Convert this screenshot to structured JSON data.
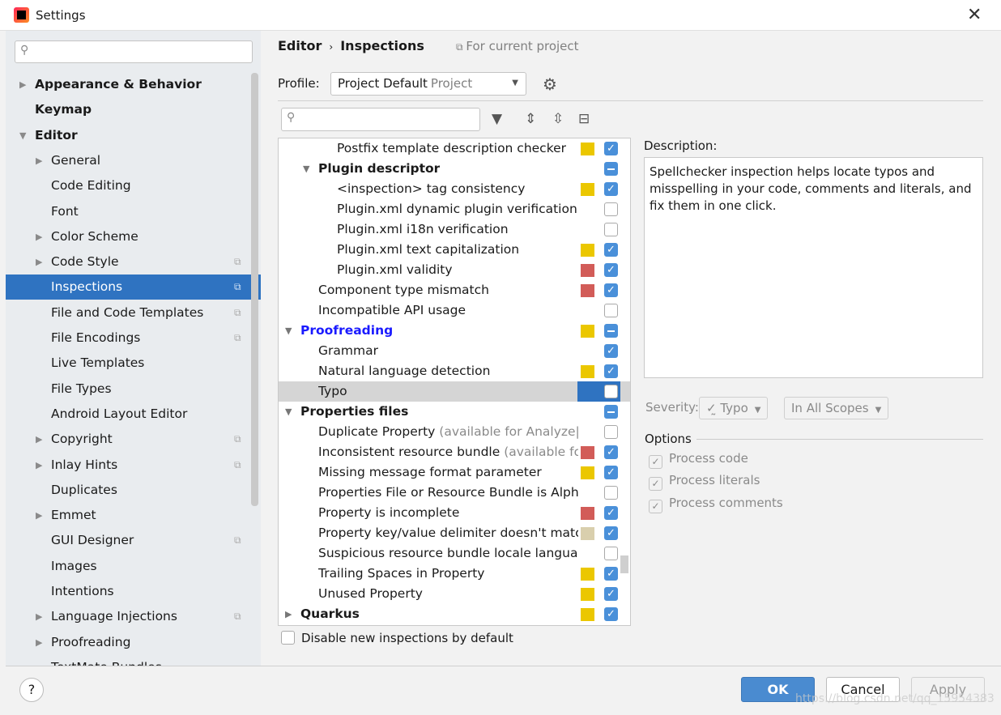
{
  "window": {
    "title": "Settings",
    "close": "✕"
  },
  "sidebar": {
    "search_placeholder": "",
    "items": [
      {
        "label": "Appearance & Behavior",
        "level": 0,
        "bold": true,
        "arrow": "right"
      },
      {
        "label": "Keymap",
        "level": 0,
        "bold": true
      },
      {
        "label": "Editor",
        "level": 0,
        "bold": true,
        "arrow": "down"
      },
      {
        "label": "General",
        "level": 1,
        "arrow": "right"
      },
      {
        "label": "Code Editing",
        "level": 1
      },
      {
        "label": "Font",
        "level": 1
      },
      {
        "label": "Color Scheme",
        "level": 1,
        "arrow": "right"
      },
      {
        "label": "Code Style",
        "level": 1,
        "arrow": "right",
        "project": true
      },
      {
        "label": "Inspections",
        "level": 1,
        "project": true,
        "selected": true
      },
      {
        "label": "File and Code Templates",
        "level": 1,
        "project": true
      },
      {
        "label": "File Encodings",
        "level": 1,
        "project": true
      },
      {
        "label": "Live Templates",
        "level": 1
      },
      {
        "label": "File Types",
        "level": 1
      },
      {
        "label": "Android Layout Editor",
        "level": 1
      },
      {
        "label": "Copyright",
        "level": 1,
        "arrow": "right",
        "project": true
      },
      {
        "label": "Inlay Hints",
        "level": 1,
        "arrow": "right",
        "project": true
      },
      {
        "label": "Duplicates",
        "level": 1
      },
      {
        "label": "Emmet",
        "level": 1,
        "arrow": "right"
      },
      {
        "label": "GUI Designer",
        "level": 1,
        "project": true
      },
      {
        "label": "Images",
        "level": 1
      },
      {
        "label": "Intentions",
        "level": 1
      },
      {
        "label": "Language Injections",
        "level": 1,
        "arrow": "right",
        "project": true
      },
      {
        "label": "Proofreading",
        "level": 1,
        "arrow": "right"
      },
      {
        "label": "TextMate Bundles",
        "level": 1
      }
    ]
  },
  "header": {
    "breadcrumb": [
      "Editor",
      "Inspections"
    ],
    "separator": "›",
    "scope": "For current project"
  },
  "profile": {
    "label": "Profile:",
    "value": "Project Default",
    "kind": "Project"
  },
  "colors": {
    "warning": "#ebc700",
    "error": "#d25c58",
    "weak": "#d9cfad",
    "accent": "#2f73c1",
    "modified": "#1a1aff"
  },
  "tree": {
    "rows": [
      {
        "label": "Postfix template description checker",
        "level": 3,
        "sev": "warning",
        "check": "on"
      },
      {
        "label": "Plugin descriptor",
        "level": 2,
        "group": true,
        "arrow": "down",
        "check": "part"
      },
      {
        "label": "<inspection> tag consistency",
        "level": 3,
        "sev": "warning",
        "check": "on"
      },
      {
        "label": "Plugin.xml dynamic plugin verification",
        "level": 3,
        "check": "off"
      },
      {
        "label": "Plugin.xml i18n verification",
        "level": 3,
        "check": "off"
      },
      {
        "label": "Plugin.xml text capitalization",
        "level": 3,
        "sev": "warning",
        "check": "on"
      },
      {
        "label": "Plugin.xml validity",
        "level": 3,
        "sev": "error",
        "check": "on"
      },
      {
        "label": "Component type mismatch",
        "level": 2,
        "sev": "error",
        "check": "on"
      },
      {
        "label": "Incompatible API usage",
        "level": 2,
        "check": "off"
      },
      {
        "label": "Proofreading",
        "level": 1,
        "group": true,
        "modified": true,
        "arrow": "down",
        "sev": "warning",
        "check": "part"
      },
      {
        "label": "Grammar",
        "level": 2,
        "check": "on"
      },
      {
        "label": "Natural language detection",
        "level": 2,
        "sev": "warning",
        "check": "on"
      },
      {
        "label": "Typo",
        "level": 2,
        "check": "off",
        "selected": true
      },
      {
        "label": "Properties files",
        "level": 1,
        "group": true,
        "arrow": "down",
        "check": "part"
      },
      {
        "label": "Duplicate Property",
        "hint": " (available for Analyze|Inspect Code)",
        "level": 2,
        "check": "off"
      },
      {
        "label": "Inconsistent resource bundle",
        "hint": " (available for Analyze|Inspect Code)",
        "level": 2,
        "sev": "error",
        "check": "on"
      },
      {
        "label": "Missing message format parameter",
        "level": 2,
        "sev": "warning",
        "check": "on"
      },
      {
        "label": "Properties File or Resource Bundle is Alphabetically Sorted",
        "level": 2,
        "check": "off"
      },
      {
        "label": "Property is incomplete",
        "level": 2,
        "sev": "error",
        "check": "on"
      },
      {
        "label": "Property key/value delimiter doesn't match code style settings",
        "level": 2,
        "sev": "weak",
        "check": "on"
      },
      {
        "label": "Suspicious resource bundle locale languages",
        "level": 2,
        "check": "off"
      },
      {
        "label": "Trailing Spaces in Property",
        "level": 2,
        "sev": "warning",
        "check": "on"
      },
      {
        "label": "Unused Property",
        "level": 2,
        "sev": "warning",
        "check": "on"
      },
      {
        "label": "Quarkus",
        "level": 1,
        "group": true,
        "arrow": "right",
        "sev": "warning",
        "check": "on"
      }
    ]
  },
  "description": {
    "label": "Description:",
    "text": "Spellchecker inspection helps locate typos and misspelling in your code, comments and literals, and fix them in one click."
  },
  "severity": {
    "label": "Severity:",
    "value": "Typo",
    "scope": "In All Scopes"
  },
  "options": {
    "label": "Options",
    "items": [
      "Process code",
      "Process literals",
      "Process comments"
    ]
  },
  "disable_new": "Disable new inspections by default",
  "footer": {
    "help": "?",
    "ok": "OK",
    "cancel": "Cancel",
    "apply": "Apply"
  },
  "watermark": "https://blog.csdn.net/qq_15954383"
}
